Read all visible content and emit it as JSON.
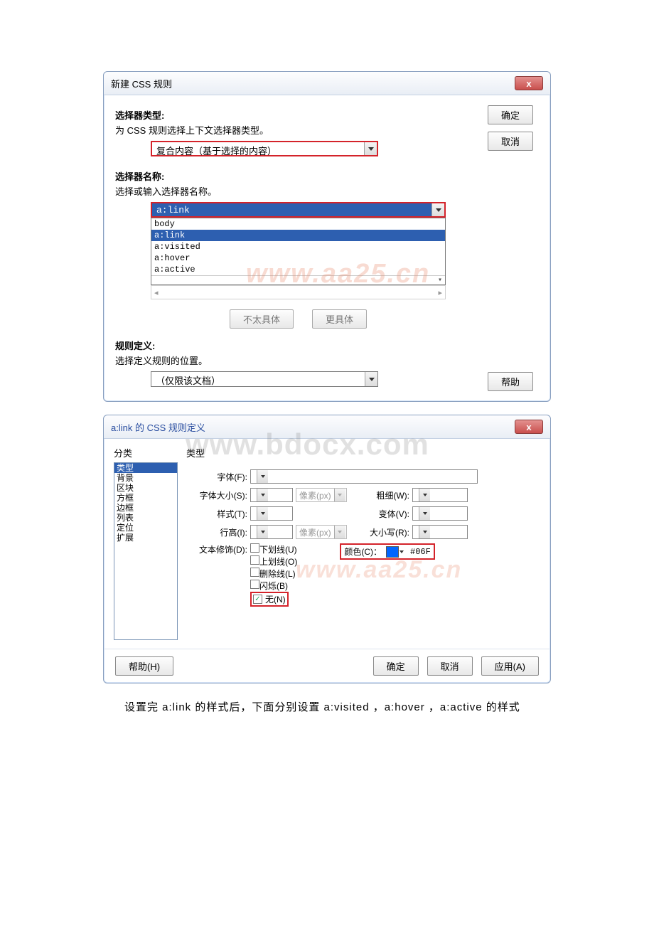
{
  "dialog1": {
    "title": "新建 CSS 规则",
    "close": "x",
    "ok": "确定",
    "cancel": "取消",
    "help": "帮助",
    "selectorType": {
      "label": "选择器类型:",
      "desc": "为 CSS 规则选择上下文选择器类型。",
      "value": "复合内容（基于选择的内容）"
    },
    "selectorName": {
      "label": "选择器名称:",
      "desc": "选择或输入选择器名称。",
      "value": "a:link",
      "options": [
        "body",
        "a:link",
        "a:visited",
        "a:hover",
        "a:active"
      ]
    },
    "lessSpecific": "不太具体",
    "moreSpecific": "更具体",
    "ruleDef": {
      "label": "规则定义:",
      "desc": "选择定义规则的位置。",
      "value": "（仅限该文档）"
    },
    "watermark": "www.aa25.cn"
  },
  "dialog2": {
    "title": "a:link 的 CSS 规则定义",
    "close": "x",
    "watermark_big": "www.bdocx.com",
    "watermark_small": "www.aa25.cn",
    "sidebar": {
      "label": "分类",
      "items": [
        "类型",
        "背景",
        "区块",
        "方框",
        "边框",
        "列表",
        "定位",
        "扩展"
      ]
    },
    "content": {
      "heading": "类型",
      "font": "字体(F):",
      "fontSize": "字体大小(S):",
      "style": "样式(T):",
      "lineHeight": "行高(I):",
      "weight": "粗细(W):",
      "variant": "变体(V):",
      "case": "大小写(R):",
      "unit": "像素(px)",
      "decoration": "文本修饰(D):",
      "underline": "下划线(U)",
      "overline": "上划线(O)",
      "strikethrough": "删除线(L)",
      "blink": "闪烁(B)",
      "none": "无(N)",
      "colorLabel": "颜色(C)：",
      "colorValue": "#06F"
    },
    "buttons": {
      "help": "帮助(H)",
      "ok": "确定",
      "cancel": "取消",
      "apply": "应用(A)"
    }
  },
  "caption": "设置完 a:link 的样式后，下面分别设置 a:visited ，a:hover ，a:active 的样式"
}
